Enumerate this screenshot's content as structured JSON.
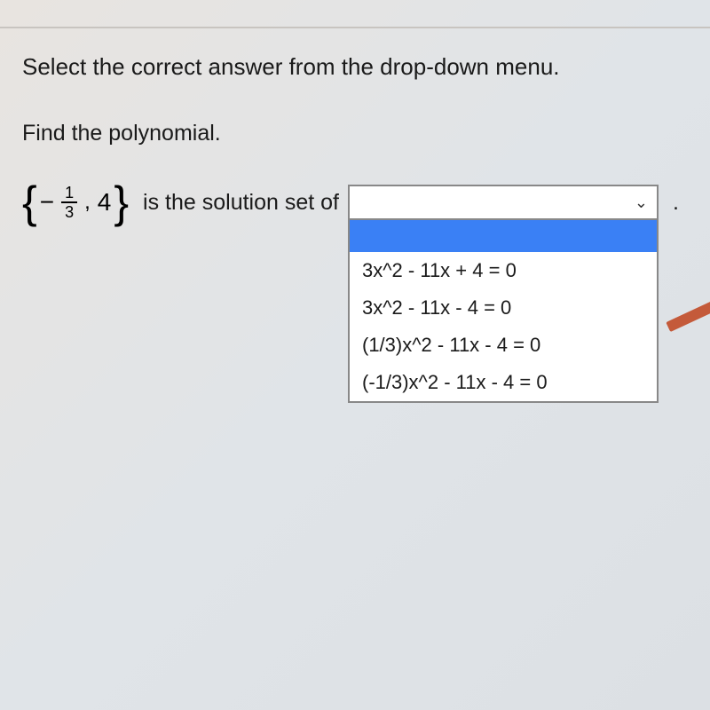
{
  "instruction": "Select the correct answer from the drop-down menu.",
  "prompt": "Find the polynomial.",
  "solution_set": {
    "minus": "−",
    "frac_num": "1",
    "frac_den": "3",
    "comma": ",",
    "second": "4"
  },
  "phrase": "is the solution set of",
  "period": ".",
  "dropdown": {
    "selected": "",
    "options": [
      "3x^2 - 11x + 4 = 0",
      "3x^2 - 11x - 4 = 0",
      "(1/3)x^2 - 11x - 4 = 0",
      "(-1/3)x^2 - 11x - 4 = 0"
    ]
  }
}
